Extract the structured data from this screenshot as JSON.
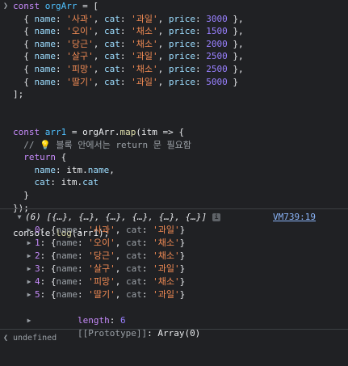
{
  "input": {
    "lines": [
      [
        [
          "kw",
          "const "
        ],
        [
          "ident",
          "orgArr"
        ],
        [
          "punc",
          " = ["
        ]
      ],
      [
        [
          "punc",
          "  { "
        ],
        [
          "prop",
          "name"
        ],
        [
          "punc",
          ": "
        ],
        [
          "str",
          "'사과'"
        ],
        [
          "punc",
          ", "
        ],
        [
          "prop",
          "cat"
        ],
        [
          "punc",
          ": "
        ],
        [
          "str",
          "'과일'"
        ],
        [
          "punc",
          ", "
        ],
        [
          "prop",
          "price"
        ],
        [
          "punc",
          ": "
        ],
        [
          "num",
          "3000"
        ],
        [
          "punc",
          " },"
        ]
      ],
      [
        [
          "punc",
          "  { "
        ],
        [
          "prop",
          "name"
        ],
        [
          "punc",
          ": "
        ],
        [
          "str",
          "'오이'"
        ],
        [
          "punc",
          ", "
        ],
        [
          "prop",
          "cat"
        ],
        [
          "punc",
          ": "
        ],
        [
          "str",
          "'채소'"
        ],
        [
          "punc",
          ", "
        ],
        [
          "prop",
          "price"
        ],
        [
          "punc",
          ": "
        ],
        [
          "num",
          "1500"
        ],
        [
          "punc",
          " },"
        ]
      ],
      [
        [
          "punc",
          "  { "
        ],
        [
          "prop",
          "name"
        ],
        [
          "punc",
          ": "
        ],
        [
          "str",
          "'당근'"
        ],
        [
          "punc",
          ", "
        ],
        [
          "prop",
          "cat"
        ],
        [
          "punc",
          ": "
        ],
        [
          "str",
          "'채소'"
        ],
        [
          "punc",
          ", "
        ],
        [
          "prop",
          "price"
        ],
        [
          "punc",
          ": "
        ],
        [
          "num",
          "2000"
        ],
        [
          "punc",
          " },"
        ]
      ],
      [
        [
          "punc",
          "  { "
        ],
        [
          "prop",
          "name"
        ],
        [
          "punc",
          ": "
        ],
        [
          "str",
          "'살구'"
        ],
        [
          "punc",
          ", "
        ],
        [
          "prop",
          "cat"
        ],
        [
          "punc",
          ": "
        ],
        [
          "str",
          "'과일'"
        ],
        [
          "punc",
          ", "
        ],
        [
          "prop",
          "price"
        ],
        [
          "punc",
          ": "
        ],
        [
          "num",
          "2500"
        ],
        [
          "punc",
          " },"
        ]
      ],
      [
        [
          "punc",
          "  { "
        ],
        [
          "prop",
          "name"
        ],
        [
          "punc",
          ": "
        ],
        [
          "str",
          "'피망'"
        ],
        [
          "punc",
          ", "
        ],
        [
          "prop",
          "cat"
        ],
        [
          "punc",
          ": "
        ],
        [
          "str",
          "'채소'"
        ],
        [
          "punc",
          ", "
        ],
        [
          "prop",
          "price"
        ],
        [
          "punc",
          ": "
        ],
        [
          "num",
          "2500"
        ],
        [
          "punc",
          " },"
        ]
      ],
      [
        [
          "punc",
          "  { "
        ],
        [
          "prop",
          "name"
        ],
        [
          "punc",
          ": "
        ],
        [
          "str",
          "'딸기'"
        ],
        [
          "punc",
          ", "
        ],
        [
          "prop",
          "cat"
        ],
        [
          "punc",
          ": "
        ],
        [
          "str",
          "'과일'"
        ],
        [
          "punc",
          ", "
        ],
        [
          "prop",
          "price"
        ],
        [
          "punc",
          ": "
        ],
        [
          "num",
          "5000"
        ],
        [
          "punc",
          " }"
        ]
      ],
      [
        [
          "punc",
          "];"
        ]
      ],
      [
        [
          "plain",
          ""
        ]
      ],
      [
        [
          "plain",
          ""
        ]
      ],
      [
        [
          "kw",
          "const "
        ],
        [
          "ident",
          "arr1"
        ],
        [
          "punc",
          " = "
        ],
        [
          "plain",
          "orgArr"
        ],
        [
          "punc",
          "."
        ],
        [
          "fn",
          "map"
        ],
        [
          "punc",
          "("
        ],
        [
          "plain",
          "itm"
        ],
        [
          "punc",
          " => {"
        ]
      ],
      [
        [
          "comment",
          "  // 💡 블록 안에서는 return 문 필요함"
        ]
      ],
      [
        [
          "kw",
          "  return"
        ],
        [
          "punc",
          " {"
        ]
      ],
      [
        [
          "punc",
          "    "
        ],
        [
          "prop",
          "name"
        ],
        [
          "punc",
          ": "
        ],
        [
          "plain",
          "itm"
        ],
        [
          "punc",
          "."
        ],
        [
          "prop",
          "name"
        ],
        [
          "punc",
          ","
        ]
      ],
      [
        [
          "punc",
          "    "
        ],
        [
          "prop",
          "cat"
        ],
        [
          "punc",
          ": "
        ],
        [
          "plain",
          "itm"
        ],
        [
          "punc",
          "."
        ],
        [
          "prop",
          "cat"
        ]
      ],
      [
        [
          "punc",
          "  }"
        ]
      ],
      [
        [
          "punc",
          "});"
        ]
      ],
      [
        [
          "plain",
          ""
        ]
      ],
      [
        [
          "plain",
          "console"
        ],
        [
          "punc",
          "."
        ],
        [
          "fn",
          "log"
        ],
        [
          "punc",
          "("
        ],
        [
          "plain",
          "arr1"
        ],
        [
          "punc",
          ");"
        ]
      ]
    ]
  },
  "output": {
    "summary": "(6) [{…}, {…}, {…}, {…}, {…}, {…}]",
    "info_badge": "i",
    "source_link": "VM739:19",
    "items": [
      {
        "index": "0",
        "name": "'사과'",
        "cat": "'과일'"
      },
      {
        "index": "1",
        "name": "'오이'",
        "cat": "'채소'"
      },
      {
        "index": "2",
        "name": "'당근'",
        "cat": "'채소'"
      },
      {
        "index": "3",
        "name": "'살구'",
        "cat": "'과일'"
      },
      {
        "index": "4",
        "name": "'피망'",
        "cat": "'채소'"
      },
      {
        "index": "5",
        "name": "'딸기'",
        "cat": "'과일'"
      }
    ],
    "length_key": "length",
    "length_value": "6",
    "prototype_key": "[[Prototype]]",
    "prototype_value": "Array(0)"
  },
  "result": {
    "text": "undefined"
  },
  "icons": {
    "prompt": "chevron-right-icon",
    "result": "chevron-left-icon",
    "expand": "triangle-down-icon",
    "collapse": "triangle-right-icon"
  }
}
